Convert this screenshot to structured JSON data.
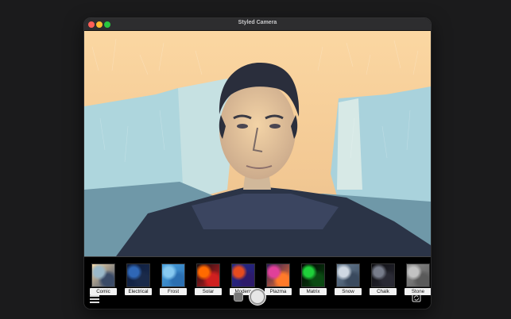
{
  "window": {
    "title": "Styled Camera"
  },
  "filters": [
    {
      "name": "Comic",
      "colors": [
        "#f6d9a8",
        "#9ab8c9",
        "#3a4a66"
      ]
    },
    {
      "name": "Electrical",
      "colors": [
        "#0d1d3f",
        "#2f67b6",
        "#1a2a4a"
      ]
    },
    {
      "name": "Frost",
      "colors": [
        "#4aa3df",
        "#87c9f0",
        "#2b6fb1"
      ]
    },
    {
      "name": "Solar",
      "colors": [
        "#1a0e14",
        "#ff6a00",
        "#d02020"
      ]
    },
    {
      "name": "Modern",
      "colors": [
        "#1e2a8a",
        "#e54b1e",
        "#2d1a6a"
      ]
    },
    {
      "name": "Plazma",
      "colors": [
        "#2a1a5a",
        "#e0409a",
        "#ff7a2a"
      ]
    },
    {
      "name": "Matrix",
      "colors": [
        "#000000",
        "#1fcf3a",
        "#0a4a12"
      ]
    },
    {
      "name": "Snow",
      "colors": [
        "#6a7f94",
        "#cfd8e2",
        "#3a4a5e"
      ]
    },
    {
      "name": "Chalk",
      "colors": [
        "#0c0c10",
        "#777c8a",
        "#2a2a34"
      ]
    },
    {
      "name": "Stone",
      "colors": [
        "#8d8d8d",
        "#c2c2c2",
        "#5a5a5a"
      ]
    }
  ],
  "icons": {
    "menu": "hamburger-menu-icon",
    "gallery": "photo-gallery-icon",
    "shutter": "shutter-button",
    "flip": "switch-camera-icon"
  },
  "colors": {
    "background": "#1b1b1c",
    "titlebar": "#2d2d2f",
    "label_bg": "#f2f2f2"
  }
}
